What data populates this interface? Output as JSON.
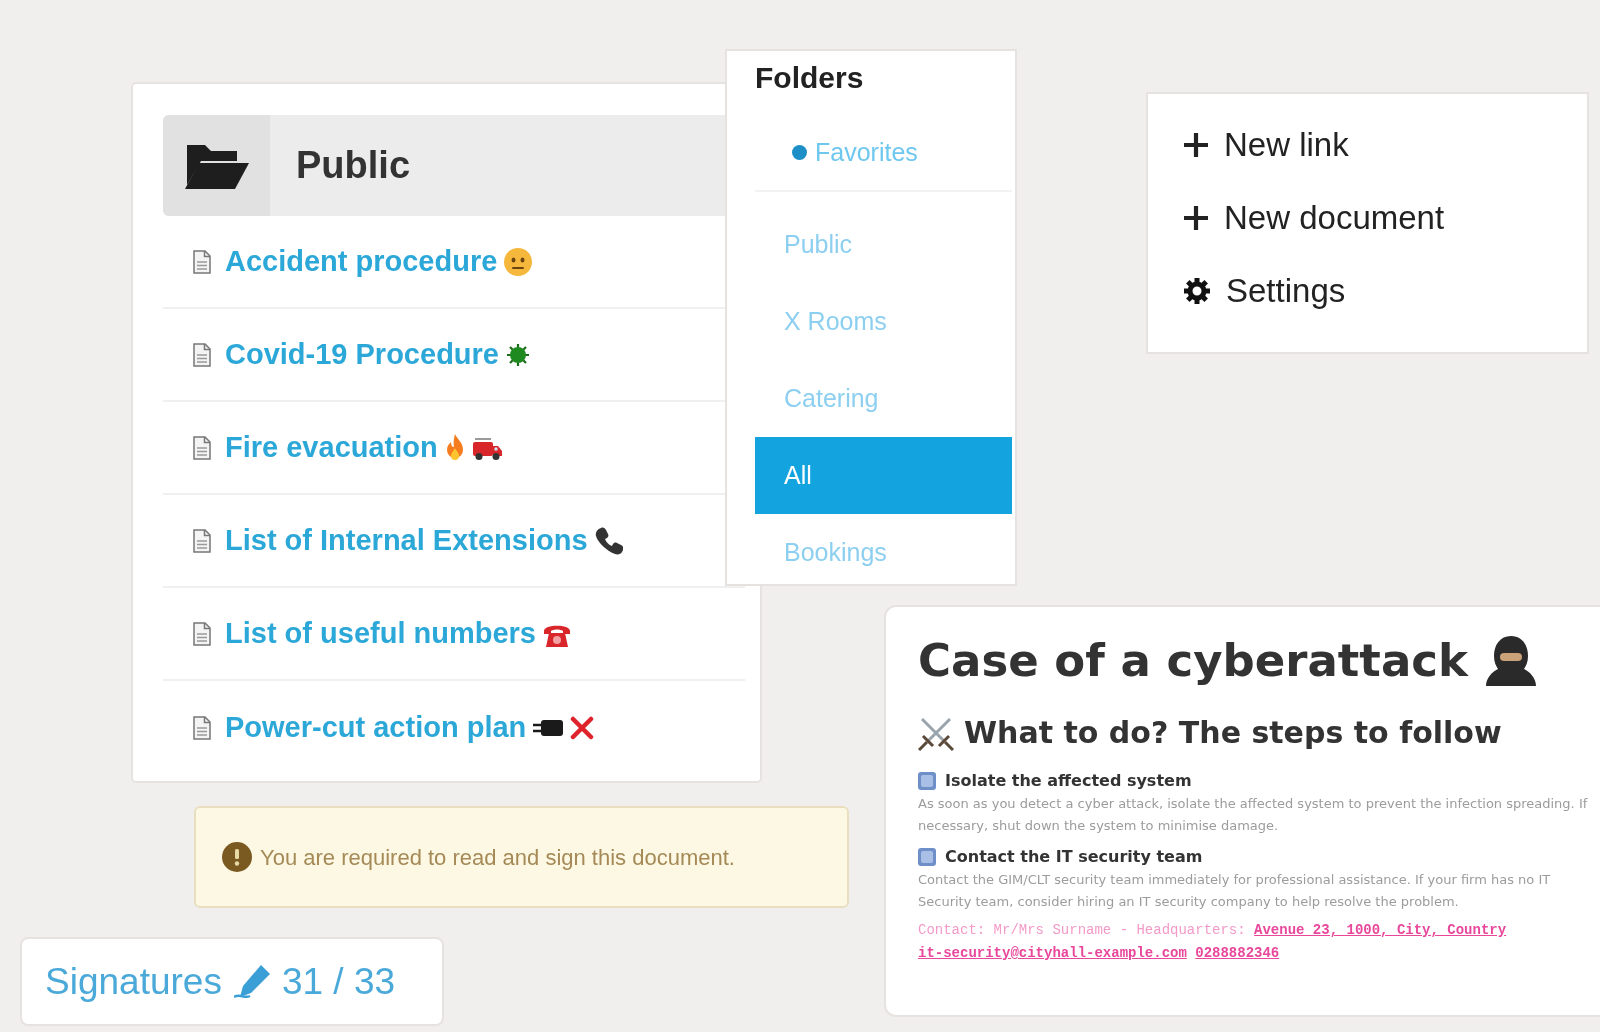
{
  "folders": {
    "title": "Folders",
    "items": [
      {
        "kind": "favorite",
        "label": "Favorites",
        "selected": false
      },
      {
        "kind": "folder",
        "label": "Public",
        "selected": false
      },
      {
        "kind": "folder",
        "label": "X Rooms",
        "selected": false
      },
      {
        "kind": "folder",
        "label": "Catering",
        "selected": false
      },
      {
        "kind": "folder",
        "label": "All",
        "selected": true
      },
      {
        "kind": "folder",
        "label": "Bookings",
        "selected": false
      }
    ]
  },
  "folder": {
    "title": "Public",
    "documents": [
      "Accident procedure",
      "Covid-19 Procedure",
      "Fire evacuation",
      "List of Internal Extensions",
      "List of useful numbers",
      "Power-cut action plan"
    ]
  },
  "menu": [
    {
      "kind": "add",
      "label": "New link"
    },
    {
      "kind": "add",
      "label": "New document"
    },
    {
      "kind": "settings",
      "label": "Settings"
    }
  ],
  "article": {
    "title": "Case of a cyberattack",
    "subtitle": "What to do? The steps to follow",
    "steps": [
      {
        "title": "Isolate the affected system",
        "body": "As soon as you detect a cyber attack, isolate the affected system to prevent the infection spreading. If necessary, shut down the system to minimise damage."
      },
      {
        "title": "Contact the IT security team",
        "body": "Contact the GIM/CLT security team immediately for professional assistance. If your firm has no IT Security team, consider hiring an IT security company to help resolve the problem."
      }
    ],
    "contact": {
      "text": "Contact: Mr/Mrs Surname - Headquarters:",
      "links": [
        "Avenue 23, 1000, City, Country",
        "it-security@cityhall-example.com",
        "0288882346"
      ]
    }
  },
  "alert": {
    "text": "You are required to read and sign this document."
  },
  "signatures": {
    "label": "Signatures",
    "count": "31 / 33"
  }
}
